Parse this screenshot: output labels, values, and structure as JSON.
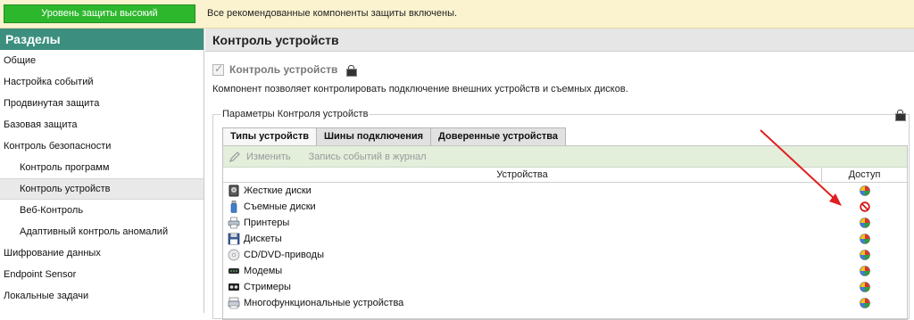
{
  "topbar": {
    "protection_label": "Уровень защиты высокий",
    "status_text": "Все рекомендованные компоненты защиты включены."
  },
  "sidebar": {
    "title": "Разделы",
    "items": [
      {
        "label": "Общие"
      },
      {
        "label": "Настройка событий"
      },
      {
        "label": "Продвинутая защита"
      },
      {
        "label": "Базовая защита"
      },
      {
        "label": "Контроль безопасности"
      },
      {
        "label": "Контроль программ"
      },
      {
        "label": "Контроль устройств"
      },
      {
        "label": "Веб-Контроль"
      },
      {
        "label": "Адаптивный контроль аномалий"
      },
      {
        "label": "Шифрование данных"
      },
      {
        "label": "Endpoint Sensor"
      },
      {
        "label": "Локальные задачи"
      }
    ]
  },
  "main": {
    "title": "Контроль устройств",
    "checkbox_label": "Контроль устройств",
    "checkbox_checked": true,
    "description": "Компонент позволяет контролировать подключение внешних устройств и съемных дисков.",
    "group_title": "Параметры Контроля устройств",
    "tabs": [
      {
        "label": "Типы устройств"
      },
      {
        "label": "Шины подключения"
      },
      {
        "label": "Доверенные устройства"
      }
    ],
    "toolbar": {
      "edit_label": "Изменить",
      "log_label": "Запись событий в журнал"
    },
    "table": {
      "col_devices": "Устройства",
      "col_access": "Доступ",
      "rows": [
        {
          "device": "Жесткие диски",
          "icon": "hard-disk-icon",
          "access": "allowed"
        },
        {
          "device": "Съемные диски",
          "icon": "usb-drive-icon",
          "access": "blocked"
        },
        {
          "device": "Принтеры",
          "icon": "printer-icon",
          "access": "allowed"
        },
        {
          "device": "Дискеты",
          "icon": "floppy-icon",
          "access": "allowed"
        },
        {
          "device": "CD/DVD-приводы",
          "icon": "cd-dvd-icon",
          "access": "allowed"
        },
        {
          "device": "Модемы",
          "icon": "modem-icon",
          "access": "allowed"
        },
        {
          "device": "Стримеры",
          "icon": "tape-drive-icon",
          "access": "allowed"
        },
        {
          "device": "Многофункциональные устройства",
          "icon": "multifunction-device-icon",
          "access": "allowed"
        }
      ]
    }
  },
  "colors": {
    "protection_green": "#2db72d",
    "sidebar_header": "#3c8f7f",
    "topbar_bg": "#fbf3cf",
    "toolbar_bg": "#e3eedb",
    "blocked_red": "#d21a1a",
    "arrow_red": "#e02020"
  }
}
